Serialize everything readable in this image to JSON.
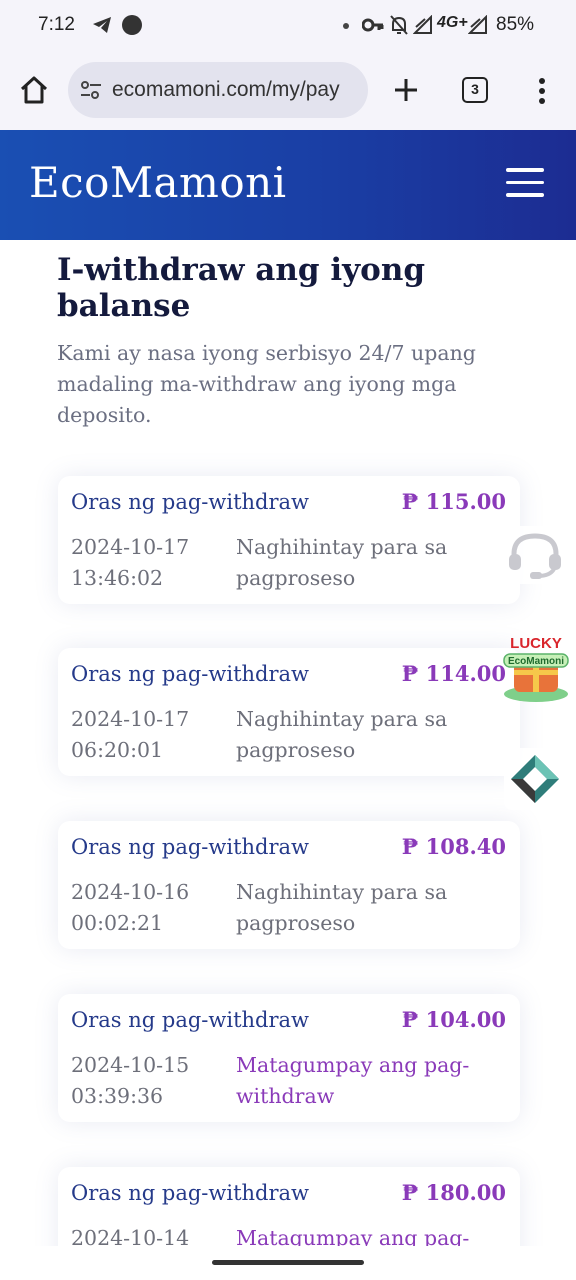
{
  "status_bar": {
    "time": "7:12",
    "network": "4G+",
    "battery": "85%",
    "icons": [
      "telegram-icon",
      "notification-dot-icon",
      "key-icon",
      "mute-icon",
      "signal-icon",
      "signal-icon"
    ]
  },
  "browser": {
    "url": "ecomamoni.com/my/pay",
    "tab_count": "3",
    "icons": [
      "home-icon",
      "site-settings-icon",
      "plus-icon",
      "tabs-icon",
      "more-vert-icon"
    ]
  },
  "site": {
    "logo": "EcoMamoni",
    "menu_icon": "hamburger-menu-icon",
    "header_colors": [
      "#1a4fb3",
      "#1c2c92"
    ]
  },
  "page": {
    "title": "I-withdraw ang iyong balanse",
    "description": "Kami ay nasa iyong serbisyo 24/7 upang madaling ma-withdraw ang iyong mga deposito."
  },
  "withdrawals": [
    {
      "label": "Oras ng pag-withdraw",
      "amount": "₱ 115.00",
      "datetime": "2024-10-17 13:46:02",
      "status": "Naghihintay para sa pagproseso",
      "state": "pending"
    },
    {
      "label": "Oras ng pag-withdraw",
      "amount": "₱ 114.00",
      "datetime": "2024-10-17 06:20:01",
      "status": "Naghihintay para sa pagproseso",
      "state": "pending"
    },
    {
      "label": "Oras ng pag-withdraw",
      "amount": "₱ 108.40",
      "datetime": "2024-10-16 00:02:21",
      "status": "Naghihintay para sa pagproseso",
      "state": "pending"
    },
    {
      "label": "Oras ng pag-withdraw",
      "amount": "₱ 104.00",
      "datetime": "2024-10-15 03:39:36",
      "status": "Matagumpay ang pag-withdraw",
      "state": "success"
    },
    {
      "label": "Oras ng pag-withdraw",
      "amount": "₱ 180.00",
      "datetime": "2024-10-14",
      "status": "Matagumpay ang pag-",
      "state": "success"
    }
  ],
  "floating": {
    "support_icon": "headset-support-icon",
    "lucky_line1": "LUCKY",
    "lucky_line2": "EcoMamoni",
    "diamond_icon": "diamond-logo-icon"
  },
  "colors": {
    "accent_purple": "#8a3ab9",
    "label_blue": "#253a8a",
    "title_navy": "#141a3d"
  }
}
